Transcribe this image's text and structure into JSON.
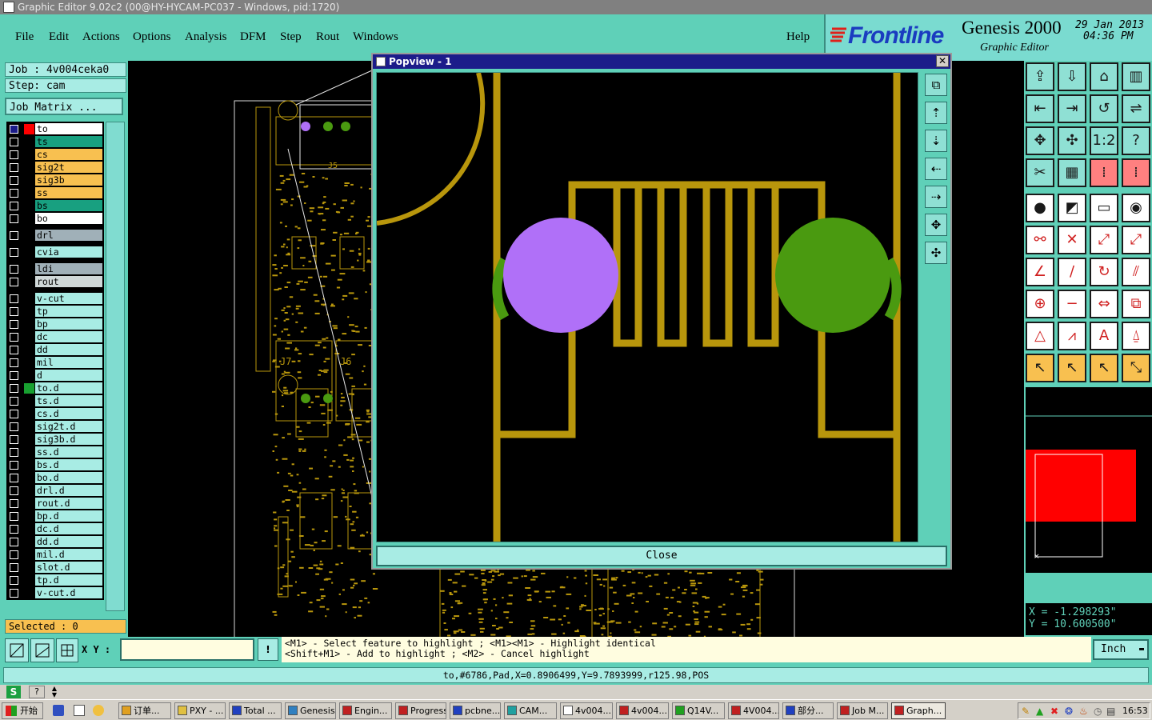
{
  "window": {
    "title": "Graphic Editor 9.02c2 (00@HY-HYCAM-PC037 - Windows, pid:1720)"
  },
  "menu": {
    "items": [
      "File",
      "Edit",
      "Actions",
      "Options",
      "Analysis",
      "DFM",
      "Step",
      "Rout",
      "Windows"
    ],
    "help": "Help"
  },
  "brand": {
    "logo": "Frontline",
    "product": "Genesis 2000",
    "subtitle": "Graphic Editor",
    "date": "29 Jan 2013",
    "time": "04:36 PM"
  },
  "job": {
    "label": "Job : 4v004ceka0",
    "step": "Step: cam",
    "matrix_button": "Job Matrix ..."
  },
  "layers": [
    {
      "name": "to",
      "color": "#ffffff",
      "sq": "#ff0000",
      "active": true
    },
    {
      "name": "ts",
      "color": "#18a080",
      "sq": ""
    },
    {
      "name": "cs",
      "color": "#f8c050",
      "sq": ""
    },
    {
      "name": "sig2t",
      "color": "#f8c050",
      "sq": ""
    },
    {
      "name": "sig3b",
      "color": "#f8c050",
      "sq": ""
    },
    {
      "name": "ss",
      "color": "#f8c050",
      "sq": ""
    },
    {
      "name": "bs",
      "color": "#18a080",
      "sq": ""
    },
    {
      "name": "bo",
      "color": "#ffffff",
      "sq": ""
    },
    {
      "name": "drl",
      "color": "#a0b0b8",
      "sq": ""
    },
    {
      "name": "cvia",
      "color": "#a8ece4",
      "sq": ""
    },
    {
      "name": "ldi",
      "color": "#a0b0b8",
      "sq": ""
    },
    {
      "name": "rout",
      "color": "#d0d8d8",
      "sq": ""
    },
    {
      "name": "v-cut",
      "color": "#a8ece4",
      "sq": ""
    },
    {
      "name": "tp",
      "color": "#a8ece4",
      "sq": ""
    },
    {
      "name": "bp",
      "color": "#a8ece4",
      "sq": ""
    },
    {
      "name": "dc",
      "color": "#a8ece4",
      "sq": ""
    },
    {
      "name": "dd",
      "color": "#a8ece4",
      "sq": ""
    },
    {
      "name": "mil",
      "color": "#a8ece4",
      "sq": ""
    },
    {
      "name": "d",
      "color": "#a8ece4",
      "sq": ""
    },
    {
      "name": "to.d",
      "color": "#a8ece4",
      "sq": "#18a030"
    },
    {
      "name": "ts.d",
      "color": "#a8ece4",
      "sq": ""
    },
    {
      "name": "cs.d",
      "color": "#a8ece4",
      "sq": ""
    },
    {
      "name": "sig2t.d",
      "color": "#a8ece4",
      "sq": ""
    },
    {
      "name": "sig3b.d",
      "color": "#a8ece4",
      "sq": ""
    },
    {
      "name": "ss.d",
      "color": "#a8ece4",
      "sq": ""
    },
    {
      "name": "bs.d",
      "color": "#a8ece4",
      "sq": ""
    },
    {
      "name": "bo.d",
      "color": "#a8ece4",
      "sq": ""
    },
    {
      "name": "drl.d",
      "color": "#a8ece4",
      "sq": ""
    },
    {
      "name": "rout.d",
      "color": "#a8ece4",
      "sq": ""
    },
    {
      "name": "bp.d",
      "color": "#a8ece4",
      "sq": ""
    },
    {
      "name": "dc.d",
      "color": "#a8ece4",
      "sq": ""
    },
    {
      "name": "dd.d",
      "color": "#a8ece4",
      "sq": ""
    },
    {
      "name": "mil.d",
      "color": "#a8ece4",
      "sq": ""
    },
    {
      "name": "slot.d",
      "color": "#a8ece4",
      "sq": ""
    },
    {
      "name": "tp.d",
      "color": "#a8ece4",
      "sq": ""
    },
    {
      "name": "v-cut.d",
      "color": "#a8ece4",
      "sq": ""
    }
  ],
  "selected": "Selected : 0",
  "popup": {
    "title": "Popview - 1",
    "close": "Close"
  },
  "coords": {
    "x": "X = -1.298293\"",
    "y": "Y = 10.600500\""
  },
  "cmd": {
    "xy_label": "X Y :",
    "xy_value": "",
    "hint1": "<M1> - Select feature to highlight ; <M1><M1> - Highlight identical",
    "hint2": "<Shift+M1> - Add to highlight ; <M2> - Cancel highlight",
    "units": "Inch"
  },
  "status": "to,#6786,Pad,X=0.8906499,Y=9.7893999,r125.98,POS",
  "taskbar": {
    "start": "开始",
    "tasks": [
      "订单...",
      "PXY - ...",
      "Total ...",
      "Genesis",
      "Engin...",
      "Progress",
      "pcbne...",
      "CAM...",
      "4v004...",
      "4v004...",
      "Q14V...",
      "4V004...",
      "部分...",
      "Job M...",
      "Graph..."
    ],
    "clock": "16:53"
  },
  "canvas_labels": [
    "J5",
    "J7",
    "J6"
  ],
  "colors": {
    "trace": "#b8960c",
    "pad_purple": "#b070f8",
    "pad_green": "#4a9a10",
    "highlight_red": "#ff0000"
  }
}
